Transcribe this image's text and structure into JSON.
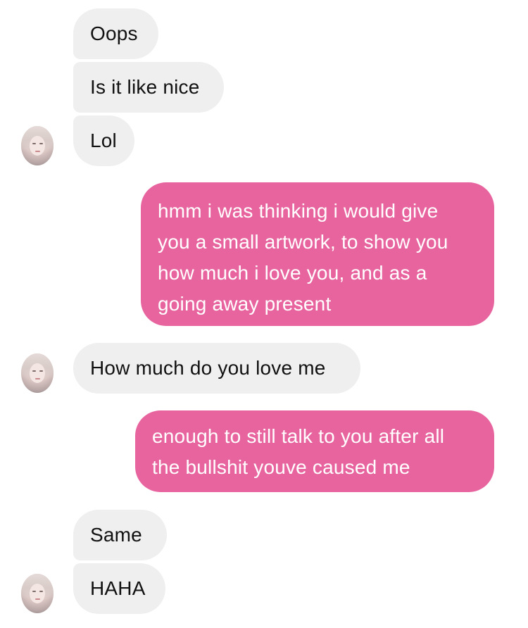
{
  "messages": [
    {
      "sender": "other",
      "text": "Oops"
    },
    {
      "sender": "other",
      "text": "Is it like nice"
    },
    {
      "sender": "other",
      "text": "Lol"
    },
    {
      "sender": "me",
      "lines": [
        "hmm i was thinking i would give",
        "you a small artwork, to show you",
        "how much i love you, and as a",
        "going away present"
      ]
    },
    {
      "sender": "other",
      "text": "How much do you love me"
    },
    {
      "sender": "me",
      "lines": [
        "enough to still talk to you after all",
        "the bullshit youve caused me"
      ]
    },
    {
      "sender": "other",
      "text": "Same"
    },
    {
      "sender": "other",
      "text": "HAHA"
    }
  ],
  "colors": {
    "incoming_bubble": "#efefef",
    "outgoing_bubble": "#e8649f",
    "incoming_text": "#111111",
    "outgoing_text": "#ffffff"
  }
}
